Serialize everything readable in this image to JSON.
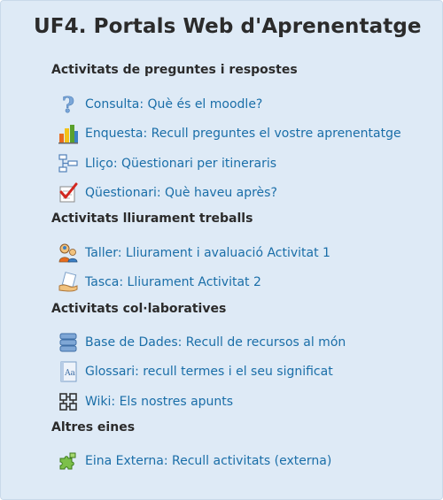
{
  "title": "UF4. Portals Web d'Aprenentatge",
  "sections": [
    {
      "heading": "Activitats de preguntes i respostes",
      "items": [
        {
          "icon": "question-icon",
          "label": "Consulta: Què és el moodle?"
        },
        {
          "icon": "bar-chart-icon",
          "label": "Enquesta: Recull preguntes el vostre aprenentatge"
        },
        {
          "icon": "flowchart-icon",
          "label": "Lliço: Qüestionari per itineraris"
        },
        {
          "icon": "checklist-icon",
          "label": "Qüestionari: Què haveu après?"
        }
      ]
    },
    {
      "heading": "Activitats lliurament treballs",
      "items": [
        {
          "icon": "workshop-people-icon",
          "label": "Taller: Lliurament i avaluació Activitat 1"
        },
        {
          "icon": "hand-paper-icon",
          "label": "Tasca: Lliurament Activitat 2"
        }
      ]
    },
    {
      "heading": "Activitats col·laboratives",
      "items": [
        {
          "icon": "database-icon",
          "label": "Base de Dades: Recull de recursos al món"
        },
        {
          "icon": "glossary-book-icon",
          "label": "Glossari: recull termes i el seu significat"
        },
        {
          "icon": "wiki-icon",
          "label": "Wiki: Els nostres apunts"
        }
      ]
    },
    {
      "heading": "Altres eines",
      "items": [
        {
          "icon": "puzzle-icon",
          "label": "Eina Externa: Recull activitats (externa)"
        }
      ]
    }
  ]
}
